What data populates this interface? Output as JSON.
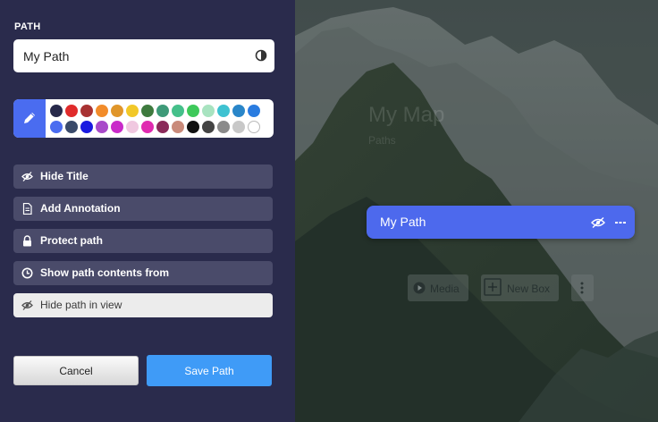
{
  "panel": {
    "section_label": "PATH",
    "name_value": "My Path",
    "contrast_icon": "half-circle-contrast-icon",
    "pencil_icon": "pencil-icon",
    "swatches": [
      "#27294a",
      "#e02b2b",
      "#a83232",
      "#f28c2a",
      "#e0962a",
      "#f2c828",
      "#3e7a3e",
      "#3e9a78",
      "#45c08a",
      "#3ec95a",
      "#a8e3c0",
      "#3ec2d1",
      "#2a86c9",
      "#2a7ce0",
      "#4a6cf0",
      "#3a4a6a",
      "#1a1ae0",
      "#a84ac9",
      "#c92ac9",
      "#f0c8e0",
      "#e02ab0",
      "#8a2a5a",
      "#c98a7a",
      "#111111",
      "#444444",
      "#8a8a8a",
      "#c8c8c8",
      "#ffffff"
    ],
    "options": [
      {
        "label": "Hide Title",
        "icon": "eye-slash-icon"
      },
      {
        "label": "Add Annotation",
        "icon": "document-icon"
      },
      {
        "label": "Protect path",
        "icon": "lock-icon"
      },
      {
        "label": "Show path contents from",
        "icon": "clock-icon"
      },
      {
        "label": "Hide path in view",
        "icon": "eye-slash-icon"
      }
    ],
    "cancel_label": "Cancel",
    "save_label": "Save Path"
  },
  "scene": {
    "ghost_title": "My Map",
    "ghost_subtitle": "Paths",
    "path_card": {
      "title": "My Path",
      "eye_icon": "eye-slash-icon",
      "more_icon": "more-dots-icon"
    },
    "buttons": [
      {
        "label": "Media",
        "icon": "play-icon"
      },
      {
        "label": "New Box",
        "icon": "plus-box-icon"
      },
      {
        "label": "",
        "icon": "vertical-dots-icon"
      }
    ]
  }
}
